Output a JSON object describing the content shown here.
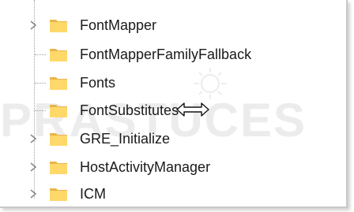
{
  "registry_tree": {
    "items": [
      {
        "label": "FontMapper",
        "expander": "chevron"
      },
      {
        "label": "FontMapperFamilyFallback",
        "expander": "none"
      },
      {
        "label": "Fonts",
        "expander": "none"
      },
      {
        "label": "FontSubstitutes",
        "expander": "none"
      },
      {
        "label": "GRE_Initialize",
        "expander": "chevron"
      },
      {
        "label": "HostActivityManager",
        "expander": "chevron"
      },
      {
        "label": "ICM",
        "expander": "chevron"
      }
    ]
  },
  "watermark": {
    "text": "PRASTUCES"
  },
  "cursor": {
    "icon": "horizontal-resize-cursor-icon"
  },
  "colors": {
    "folder_front": "#ffd86a",
    "folder_back": "#e8b54a",
    "chevron": "#8a8a8a",
    "text": "#1a1a1a"
  }
}
